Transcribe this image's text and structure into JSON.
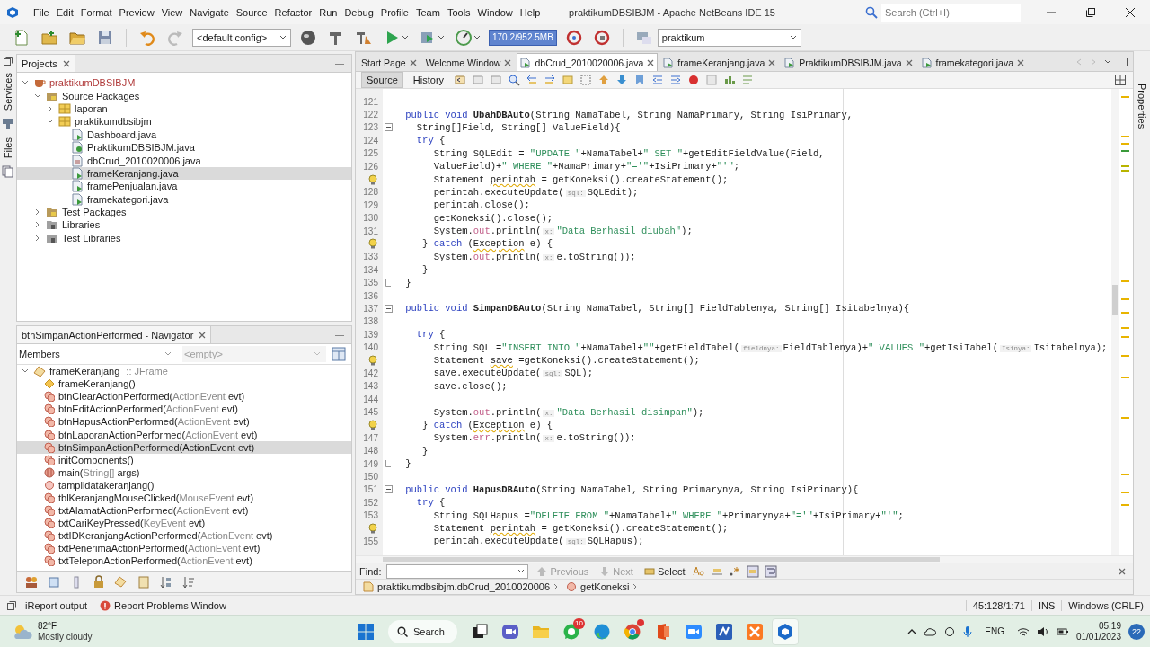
{
  "title_bar": {
    "menus": [
      "File",
      "Edit",
      "Format",
      "Preview",
      "View",
      "Navigate",
      "Source",
      "Refactor",
      "Run",
      "Debug",
      "Profile",
      "Team",
      "Tools",
      "Window",
      "Help"
    ],
    "title": "praktikumDBSIBJM - Apache NetBeans IDE 15",
    "search": {
      "placeholder": "Search (Ctrl+I)"
    }
  },
  "toolbar": {
    "config": "<default config>",
    "memory": "170.2/952.5MB",
    "project": "praktikum"
  },
  "side_tabs": [
    "Services",
    "Files"
  ],
  "projects": {
    "title": "Projects",
    "tree": [
      {
        "label": "praktikumDBSIBJM",
        "kind": "project",
        "expanded": true,
        "selected": false,
        "children": [
          {
            "label": "Source Packages",
            "kind": "sources",
            "expanded": true,
            "selected": false,
            "children": [
              {
                "label": "laporan",
                "kind": "package",
                "expanded": false,
                "selected": false
              },
              {
                "label": "praktikumdbsibjm",
                "kind": "package",
                "expanded": true,
                "selected": false,
                "children": [
                  {
                    "label": "Dashboard.java",
                    "kind": "form",
                    "selected": false
                  },
                  {
                    "label": "PraktikumDBSIBJM.java",
                    "kind": "main",
                    "selected": false
                  },
                  {
                    "label": "dbCrud_2010020006.java",
                    "kind": "class",
                    "selected": false
                  },
                  {
                    "label": "frameKeranjang.java",
                    "kind": "form",
                    "selected": true
                  },
                  {
                    "label": "framePenjualan.java",
                    "kind": "form",
                    "selected": false
                  },
                  {
                    "label": "framekategori.java",
                    "kind": "form",
                    "selected": false
                  }
                ]
              }
            ]
          },
          {
            "label": "Test Packages",
            "kind": "sources",
            "expanded": false,
            "selected": false
          },
          {
            "label": "Libraries",
            "kind": "library",
            "expanded": false,
            "selected": false
          },
          {
            "label": "Test Libraries",
            "kind": "library",
            "expanded": false,
            "selected": false
          }
        ]
      }
    ]
  },
  "navigator": {
    "title": "btnSimpanActionPerformed - Navigator",
    "filter": "Members",
    "filter_2": "<empty>",
    "root": {
      "label": "frameKeranjang",
      "type": " :: JFrame",
      "expanded": true
    },
    "members": [
      {
        "kind": "constructor",
        "label": "frameKeranjang()",
        "selected": false
      },
      {
        "kind": "method",
        "label": "btnClearActionPerformed(",
        "type": "ActionEvent",
        "rest": " evt)",
        "selected": false
      },
      {
        "kind": "method",
        "label": "btnEditActionPerformed(",
        "type": "ActionEvent",
        "rest": " evt)",
        "selected": false
      },
      {
        "kind": "method",
        "label": "btnHapusActionPerformed(",
        "type": "ActionEvent",
        "rest": " evt)",
        "selected": false
      },
      {
        "kind": "method",
        "label": "btnLaporanActionPerformed(",
        "type": "ActionEvent",
        "rest": " evt)",
        "selected": false
      },
      {
        "kind": "method",
        "label": "btnSimpanActionPerformed(ActionEvent evt)",
        "selected": true
      },
      {
        "kind": "method",
        "label": "initComponents()",
        "selected": false
      },
      {
        "kind": "static",
        "label": "main(",
        "type": "String[]",
        "rest": " args)",
        "selected": false
      },
      {
        "kind": "private",
        "label": "tampildatakeranjang()",
        "selected": false
      },
      {
        "kind": "method",
        "label": "tblKeranjangMouseClicked(",
        "type": "MouseEvent",
        "rest": " evt)",
        "selected": false
      },
      {
        "kind": "method",
        "label": "txtAlamatActionPerformed(",
        "type": "ActionEvent",
        "rest": " evt)",
        "selected": false
      },
      {
        "kind": "method",
        "label": "txtCariKeyPressed(",
        "type": "KeyEvent",
        "rest": " evt)",
        "selected": false
      },
      {
        "kind": "method",
        "label": "txtIDKeranjangActionPerformed(",
        "type": "ActionEvent",
        "rest": " evt)",
        "selected": false
      },
      {
        "kind": "method",
        "label": "txtPenerimaActionPerformed(",
        "type": "ActionEvent",
        "rest": " evt)",
        "selected": false
      },
      {
        "kind": "method",
        "label": "txtTeleponActionPerformed(",
        "type": "ActionEvent",
        "rest": " evt)",
        "selected": false
      }
    ]
  },
  "editor": {
    "tabs": [
      {
        "label": "Start Page",
        "selected": false
      },
      {
        "label": "Welcome Window",
        "selected": false
      },
      {
        "label": "dbCrud_2010020006.java",
        "selected": true
      },
      {
        "label": "frameKeranjang.java",
        "selected": false
      },
      {
        "label": "PraktikumDBSIBJM.java",
        "selected": false
      },
      {
        "label": "framekategori.java",
        "selected": false
      }
    ],
    "views": [
      {
        "label": "Source",
        "selected": true
      },
      {
        "label": "History",
        "selected": false
      }
    ],
    "lines": [
      {
        "n": "121",
        "kind": "plain"
      },
      {
        "n": "122",
        "kind": "plain",
        "tokens": [
          {
            "kind": "kw",
            "text": "  public void "
          },
          {
            "kind": "bold",
            "text": "UbahDBAuto"
          },
          {
            "kind": "plain",
            "text": "(String NamaTabel, String NamaPrimary, String IsiPrimary,"
          }
        ]
      },
      {
        "n": "123",
        "kind": "fold",
        "tokens": [
          {
            "kind": "plain",
            "text": "    String[]Field, String[] ValueField){"
          }
        ]
      },
      {
        "n": "124",
        "kind": "plain",
        "tokens": [
          {
            "kind": "kw",
            "text": "    try"
          },
          {
            "kind": "plain",
            "text": " {"
          }
        ]
      },
      {
        "n": "125",
        "kind": "plain",
        "tokens": [
          {
            "kind": "plain",
            "text": "       String SQLEdit = "
          },
          {
            "kind": "str",
            "text": "\"UPDATE \""
          },
          {
            "kind": "plain",
            "text": "+NamaTabel+"
          },
          {
            "kind": "str",
            "text": "\" SET \""
          },
          {
            "kind": "plain",
            "text": "+getEditFieldValue(Field,"
          }
        ]
      },
      {
        "n": "126",
        "kind": "plain",
        "tokens": [
          {
            "kind": "plain",
            "text": "       ValueField)+"
          },
          {
            "kind": "str",
            "text": "\" WHERE \""
          },
          {
            "kind": "plain",
            "text": "+NamaPrimary+"
          },
          {
            "kind": "str",
            "text": "\"='\""
          },
          {
            "kind": "plain",
            "text": "+IsiPrimary+"
          },
          {
            "kind": "str",
            "text": "\"'\""
          },
          {
            "kind": "plain",
            "text": ";"
          }
        ]
      },
      {
        "kind": "bulb",
        "tokens": [
          {
            "kind": "plain",
            "text": "       Statement "
          },
          {
            "kind": "warn",
            "text": "perintah"
          },
          {
            "kind": "plain",
            "text": " = getKoneksi().createStatement();"
          }
        ]
      },
      {
        "n": "128",
        "kind": "plain",
        "tokens": [
          {
            "kind": "plain",
            "text": "       perintah.executeUpdate("
          },
          {
            "kind": "hint",
            "text": "sql:"
          },
          {
            "kind": "plain",
            "text": "SQLEdit);"
          }
        ]
      },
      {
        "n": "129",
        "kind": "plain",
        "tokens": [
          {
            "kind": "plain",
            "text": "       perintah.close();"
          }
        ]
      },
      {
        "n": "130",
        "kind": "plain",
        "tokens": [
          {
            "kind": "plain",
            "text": "       getKoneksi().close();"
          }
        ]
      },
      {
        "n": "131",
        "kind": "plain",
        "tokens": [
          {
            "kind": "plain",
            "text": "       System."
          },
          {
            "kind": "field",
            "text": "out"
          },
          {
            "kind": "plain",
            "text": ".println("
          },
          {
            "kind": "hint",
            "text": "x:"
          },
          {
            "kind": "str",
            "text": "\"Data Berhasil diubah\""
          },
          {
            "kind": "plain",
            "text": ");"
          }
        ]
      },
      {
        "kind": "bulb",
        "tokens": [
          {
            "kind": "plain",
            "text": "     } "
          },
          {
            "kind": "kw",
            "text": "catch"
          },
          {
            "kind": "plain",
            "text": " ("
          },
          {
            "kind": "warn",
            "text": "Exception"
          },
          {
            "kind": "plain",
            "text": " e) {"
          }
        ]
      },
      {
        "n": "133",
        "kind": "plain",
        "tokens": [
          {
            "kind": "plain",
            "text": "       System."
          },
          {
            "kind": "field",
            "text": "out"
          },
          {
            "kind": "plain",
            "text": ".println("
          },
          {
            "kind": "hint",
            "text": "x:"
          },
          {
            "kind": "plain",
            "text": "e.toString());"
          }
        ]
      },
      {
        "n": "134",
        "kind": "plain",
        "tokens": [
          {
            "kind": "plain",
            "text": "     }"
          }
        ]
      },
      {
        "n": "135",
        "kind": "fold-end",
        "tokens": [
          {
            "kind": "plain",
            "text": "  }"
          }
        ]
      },
      {
        "n": "136",
        "kind": "plain"
      },
      {
        "n": "137",
        "kind": "fold",
        "tokens": [
          {
            "kind": "kw",
            "text": "  public void "
          },
          {
            "kind": "bold",
            "text": "SimpanDBAuto"
          },
          {
            "kind": "plain",
            "text": "(String NamaTabel, String[] FieldTablenya, String[] Isitabelnya){"
          }
        ]
      },
      {
        "n": "138",
        "kind": "plain"
      },
      {
        "n": "139",
        "kind": "plain",
        "tokens": [
          {
            "kind": "kw",
            "text": "    try"
          },
          {
            "kind": "plain",
            "text": " {"
          }
        ]
      },
      {
        "n": "140",
        "kind": "plain",
        "tokens": [
          {
            "kind": "plain",
            "text": "       String SQL ="
          },
          {
            "kind": "str",
            "text": "\"INSERT INTO \""
          },
          {
            "kind": "plain",
            "text": "+NamaTabel+"
          },
          {
            "kind": "str",
            "text": "\"\""
          },
          {
            "kind": "plain",
            "text": "+getFieldTabel("
          },
          {
            "kind": "hint",
            "text": "fieldnya:"
          },
          {
            "kind": "plain",
            "text": "FieldTablenya)+"
          },
          {
            "kind": "str",
            "text": "\" VALUES \""
          },
          {
            "kind": "plain",
            "text": "+getIsiTabel("
          },
          {
            "kind": "hint",
            "text": "Isinya:"
          },
          {
            "kind": "plain",
            "text": "Isitabelnya);"
          }
        ]
      },
      {
        "kind": "bulb",
        "tokens": [
          {
            "kind": "plain",
            "text": "       Statement "
          },
          {
            "kind": "warn",
            "text": "save"
          },
          {
            "kind": "plain",
            "text": " =getKoneksi().createStatement();"
          }
        ]
      },
      {
        "n": "142",
        "kind": "plain",
        "tokens": [
          {
            "kind": "plain",
            "text": "       save.executeUpdate("
          },
          {
            "kind": "hint",
            "text": "sql:"
          },
          {
            "kind": "plain",
            "text": "SQL);"
          }
        ]
      },
      {
        "n": "143",
        "kind": "plain",
        "tokens": [
          {
            "kind": "plain",
            "text": "       save.close();"
          }
        ]
      },
      {
        "n": "144",
        "kind": "plain"
      },
      {
        "n": "145",
        "kind": "plain",
        "tokens": [
          {
            "kind": "plain",
            "text": "       System."
          },
          {
            "kind": "field",
            "text": "out"
          },
          {
            "kind": "plain",
            "text": ".println("
          },
          {
            "kind": "hint",
            "text": "x:"
          },
          {
            "kind": "str",
            "text": "\"Data Berhasil disimpan\""
          },
          {
            "kind": "plain",
            "text": ");"
          }
        ]
      },
      {
        "kind": "bulb",
        "tokens": [
          {
            "kind": "plain",
            "text": "     } "
          },
          {
            "kind": "kw",
            "text": "catch"
          },
          {
            "kind": "plain",
            "text": " ("
          },
          {
            "kind": "warn",
            "text": "Exception"
          },
          {
            "kind": "plain",
            "text": " e) {"
          }
        ]
      },
      {
        "n": "147",
        "kind": "plain",
        "tokens": [
          {
            "kind": "plain",
            "text": "       System."
          },
          {
            "kind": "field",
            "text": "err"
          },
          {
            "kind": "plain",
            "text": ".println("
          },
          {
            "kind": "hint",
            "text": "x:"
          },
          {
            "kind": "plain",
            "text": "e.toString());"
          }
        ]
      },
      {
        "n": "148",
        "kind": "plain",
        "tokens": [
          {
            "kind": "plain",
            "text": "     }"
          }
        ]
      },
      {
        "n": "149",
        "kind": "fold-end",
        "tokens": [
          {
            "kind": "plain",
            "text": "  }"
          }
        ]
      },
      {
        "n": "150",
        "kind": "plain"
      },
      {
        "n": "151",
        "kind": "fold",
        "tokens": [
          {
            "kind": "kw",
            "text": "  public void "
          },
          {
            "kind": "bold",
            "text": "HapusDBAuto"
          },
          {
            "kind": "plain",
            "text": "(String NamaTabel, String Primarynya, String IsiPrimary){"
          }
        ]
      },
      {
        "n": "152",
        "kind": "plain",
        "tokens": [
          {
            "kind": "kw",
            "text": "    try"
          },
          {
            "kind": "plain",
            "text": " {"
          }
        ]
      },
      {
        "n": "153",
        "kind": "plain",
        "tokens": [
          {
            "kind": "plain",
            "text": "       String SQLHapus ="
          },
          {
            "kind": "str",
            "text": "\"DELETE FROM \""
          },
          {
            "kind": "plain",
            "text": "+NamaTabel+"
          },
          {
            "kind": "str",
            "text": "\" WHERE \""
          },
          {
            "kind": "plain",
            "text": "+Primarynya+"
          },
          {
            "kind": "str",
            "text": "\"='\""
          },
          {
            "kind": "plain",
            "text": "+IsiPrimary+"
          },
          {
            "kind": "str",
            "text": "\"'\""
          },
          {
            "kind": "plain",
            "text": ";"
          }
        ]
      },
      {
        "kind": "bulb",
        "tokens": [
          {
            "kind": "plain",
            "text": "       Statement "
          },
          {
            "kind": "warn",
            "text": "perintah"
          },
          {
            "kind": "plain",
            "text": " = getKoneksi().createStatement();"
          }
        ]
      },
      {
        "n": "155",
        "kind": "plain",
        "tokens": [
          {
            "kind": "plain",
            "text": "       perintah.executeUpdate("
          },
          {
            "kind": "hint",
            "text": "sql:"
          },
          {
            "kind": "plain",
            "text": "SQLHapus);"
          }
        ]
      }
    ],
    "find": {
      "label": "Find:",
      "buttons": [
        {
          "kind": "previous",
          "label": "Previous",
          "disabled": true
        },
        {
          "kind": "next",
          "label": "Next",
          "disabled": true
        },
        {
          "kind": "select",
          "label": "Select",
          "disabled": false
        }
      ]
    },
    "breadcrumbs": [
      {
        "kind": "class",
        "label": "praktikumdbsibjm.dbCrud_2010020006"
      },
      {
        "kind": "method",
        "label": "getKoneksi"
      }
    ]
  },
  "right_tab": "Properties",
  "status_bar": {
    "items": [
      {
        "kind": "output",
        "label": "iReport output"
      },
      {
        "kind": "problems",
        "label": "Report Problems Window"
      }
    ],
    "position": "45:128/1:71",
    "mode": "INS",
    "line_endings": "Windows (CRLF)"
  },
  "taskbar": {
    "weather": {
      "temperature": "82°F",
      "condition": "Mostly cloudy"
    },
    "search": "Search",
    "apps": [
      {
        "kind": "taskview",
        "active": false,
        "alert": false
      },
      {
        "kind": "meet",
        "active": false,
        "alert": false
      },
      {
        "kind": "folder",
        "active": false,
        "alert": false
      },
      {
        "kind": "chat",
        "active": false,
        "alert": false,
        "badge": "10"
      },
      {
        "kind": "edge",
        "active": false,
        "alert": false
      },
      {
        "kind": "chrome",
        "active": false,
        "alert": true
      },
      {
        "kind": "office",
        "active": false,
        "alert": false
      },
      {
        "kind": "zoom",
        "active": false,
        "alert": false
      },
      {
        "kind": "code",
        "active": false,
        "alert": false
      },
      {
        "kind": "xampp",
        "active": false,
        "alert": false
      },
      {
        "kind": "netbeans",
        "active": true,
        "alert": false
      }
    ],
    "language": "ENG",
    "time": "05.19",
    "date": "01/01/2023",
    "notifications": "22"
  }
}
